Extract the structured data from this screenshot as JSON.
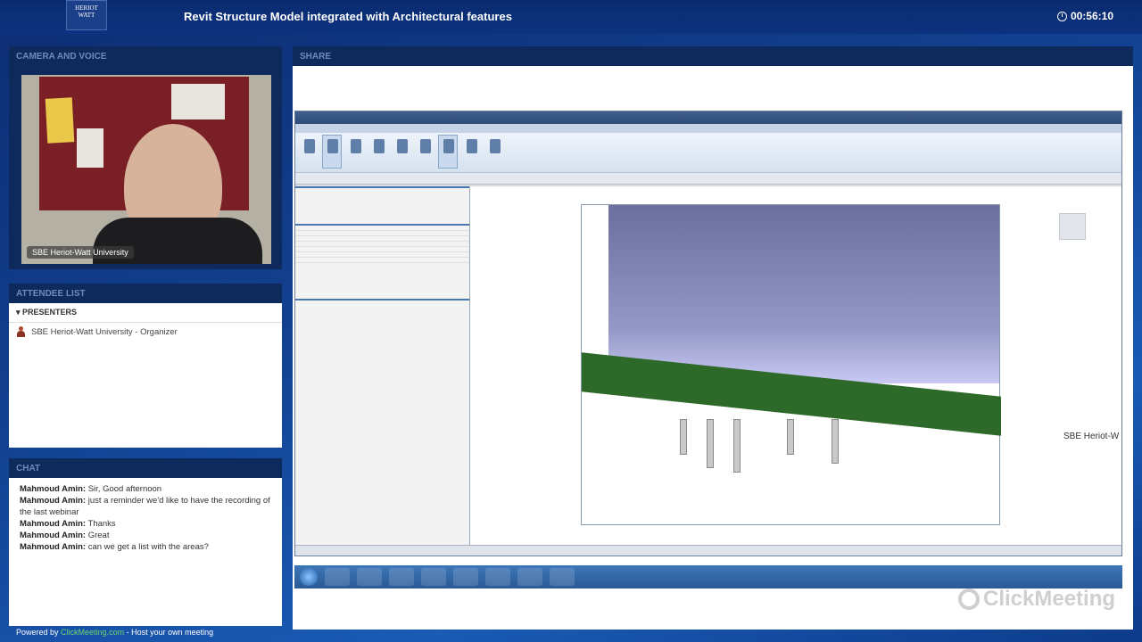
{
  "header": {
    "logo_text": "HERIOT WATT",
    "title": "Revit Structure Model integrated with Architectural features",
    "timer": "00:56:10"
  },
  "camera": {
    "heading": "CAMERA AND VOICE",
    "label": "SBE Heriot-Watt University"
  },
  "attendees": {
    "heading": "ATTENDEE LIST",
    "group": "PRESENTERS",
    "items": [
      {
        "name": "SBE Heriot-Watt University - Organizer"
      }
    ]
  },
  "chat": {
    "heading": "CHAT",
    "messages": [
      {
        "author": "Mahmoud Amin:",
        "text": "Sir, Good afternoon"
      },
      {
        "author": "Mahmoud Amin:",
        "text": "just a reminder we'd like to have the recording of the last webinar"
      },
      {
        "author": "Mahmoud Amin:",
        "text": "Thanks"
      },
      {
        "author": "Mahmoud Amin:",
        "text": "Great"
      },
      {
        "author": "Mahmoud Amin:",
        "text": "can we get a list with the areas?"
      }
    ]
  },
  "footer": {
    "powered_prefix": "Powered by",
    "powered_link": "ClickMeeting.com",
    "powered_suffix": "- Host your own meeting"
  },
  "share": {
    "heading": "SHARE",
    "cursor_label": "SBE Heriot-W",
    "watermark": "ClickMeeting"
  },
  "colors": {
    "background": "#12408f",
    "panel_header": "#0e2a5c",
    "accent_green": "#6fd46f"
  }
}
